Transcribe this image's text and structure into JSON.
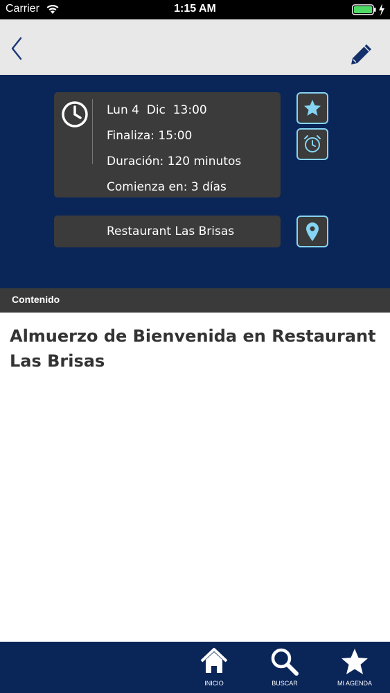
{
  "status_bar": {
    "carrier": "Carrier",
    "time": "1:15 AM",
    "battery_color": "#4cd964"
  },
  "nav": {
    "back_icon": "chevron-left-icon",
    "edit_icon": "pencil-icon"
  },
  "event": {
    "start": "Lun 4  Dic  13:00",
    "end": "Finaliza: 15:00",
    "duration": "Duración: 120 minutos",
    "starts_in": "Comienza en: 3 días",
    "location": "Restaurant Las Brisas"
  },
  "content": {
    "section_label": "Contenido",
    "title": "Almuerzo de Bienvenida en Restaurant Las Brisas"
  },
  "tabs": [
    {
      "label": "INICIO",
      "icon": "home-icon"
    },
    {
      "label": "BUSCAR",
      "icon": "search-icon"
    },
    {
      "label": "MI AGENDA",
      "icon": "star-icon"
    }
  ],
  "colors": {
    "hero_background": "#0a2558",
    "accent": "#85d4f3",
    "card_background": "#3b3b3b"
  }
}
